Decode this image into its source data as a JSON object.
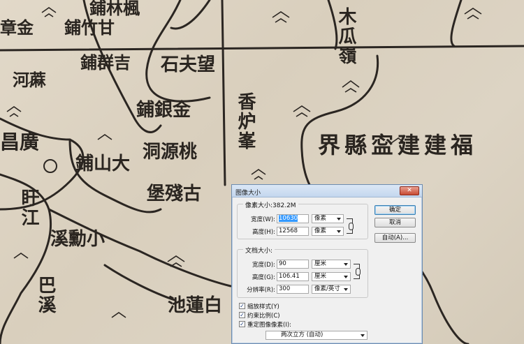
{
  "map": {
    "labels": [
      {
        "text": "鋪林楓",
        "vertical": false
      },
      {
        "text": "章金",
        "vertical": false
      },
      {
        "text": "鋪竹甘",
        "vertical": false
      },
      {
        "text": "鋪群吉",
        "vertical": false
      },
      {
        "text": "石夫望",
        "vertical": false
      },
      {
        "text": "木瓜嶺",
        "vertical": true
      },
      {
        "text": "河蔴",
        "vertical": false
      },
      {
        "text": "鋪銀金",
        "vertical": false
      },
      {
        "text": "香炉峯",
        "vertical": true
      },
      {
        "text": "界縣寍建建福",
        "vertical": false
      },
      {
        "text": "昌廣",
        "vertical": false
      },
      {
        "text": "洞源桃",
        "vertical": false
      },
      {
        "text": "鋪山大",
        "vertical": false
      },
      {
        "text": "堡殘古",
        "vertical": false
      },
      {
        "text": "盱江",
        "vertical": true
      },
      {
        "text": "溪勳小",
        "vertical": false
      },
      {
        "text": "巴溪",
        "vertical": true
      },
      {
        "text": "池蓮白",
        "vertical": false
      }
    ]
  },
  "dialog": {
    "title": "图像大小",
    "close_label": "✕",
    "pixel_dims": {
      "legend": "像素大小:382.2M",
      "width_label": "宽度(W):",
      "width_value": "10630",
      "width_unit": "像素",
      "height_label": "高度(H):",
      "height_value": "12568",
      "height_unit": "像素"
    },
    "doc_size": {
      "legend": "文档大小:",
      "width_label": "宽度(D):",
      "width_value": "90",
      "width_unit": "厘米",
      "height_label": "高度(G):",
      "height_value": "106.41",
      "height_unit": "厘米",
      "res_label": "分辨率(R):",
      "res_value": "300",
      "res_unit": "像素/英寸"
    },
    "buttons": {
      "ok": "确定",
      "cancel": "取消",
      "auto": "自动(A)..."
    },
    "options": [
      {
        "label": "缩放样式(Y)",
        "checked": true
      },
      {
        "label": "约束比例(C)",
        "checked": true
      },
      {
        "label": "重定图像像素(I):",
        "checked": true
      }
    ],
    "resample_method": "两次立方 (自动)"
  }
}
